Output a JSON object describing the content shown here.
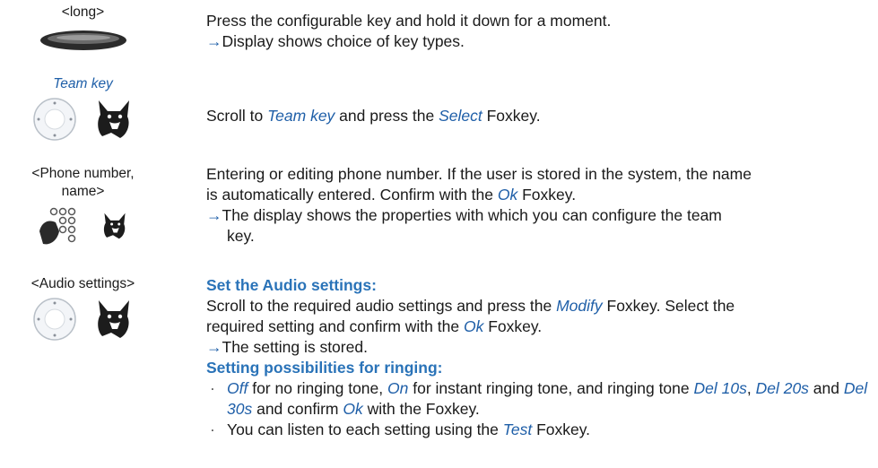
{
  "step1": {
    "label": "<long>",
    "line1": "Press the configurable key and hold it down for a moment.",
    "line2": "Display shows choice of key types."
  },
  "step2": {
    "label": "Team key",
    "t1": "Scroll to ",
    "em1": "Team key",
    "t2": " and press the ",
    "em2": "Select",
    "t3": " Foxkey."
  },
  "step3": {
    "label1": "<Phone number,",
    "label2": "name>",
    "l1": "Entering or editing phone number. If the user is stored in the system, the name",
    "l2a": "is automatically entered. Confirm with the ",
    "l2em": "Ok",
    "l2b": " Foxkey.",
    "l3": "The display shows the properties with which you can configure the team",
    "l4": "key."
  },
  "step4": {
    "label": "<Audio settings>",
    "heading1": "Set the Audio settings:",
    "l1a": "Scroll to the required audio settings and press the ",
    "l1em": "Modify",
    "l1b": " Foxkey. Select the",
    "l2a": "required setting and confirm with the ",
    "l2em": "Ok",
    "l2b": " Foxkey.",
    "l3": "The setting is stored.",
    "heading2": "Setting possibilities for ringing:",
    "b1_em1": "Off",
    "b1_t1": " for no ringing tone, ",
    "b1_em2": "On",
    "b1_t2": " for instant ringing tone, and ringing tone ",
    "b1_em3": "Del 10s",
    "b1_t3": ",",
    "b1_em4": "Del 20s",
    "b1_t4": " and ",
    "b1_em5": "Del 30s",
    "b1_t5": " and confirm ",
    "b1_em6": "Ok",
    "b1_t6": " with the Foxkey.",
    "b2_t1": "You can listen to each setting using the ",
    "b2_em": "Test",
    "b2_t2": " Foxkey."
  },
  "glyphs": {
    "arrow": "→",
    "bullet": "·"
  }
}
